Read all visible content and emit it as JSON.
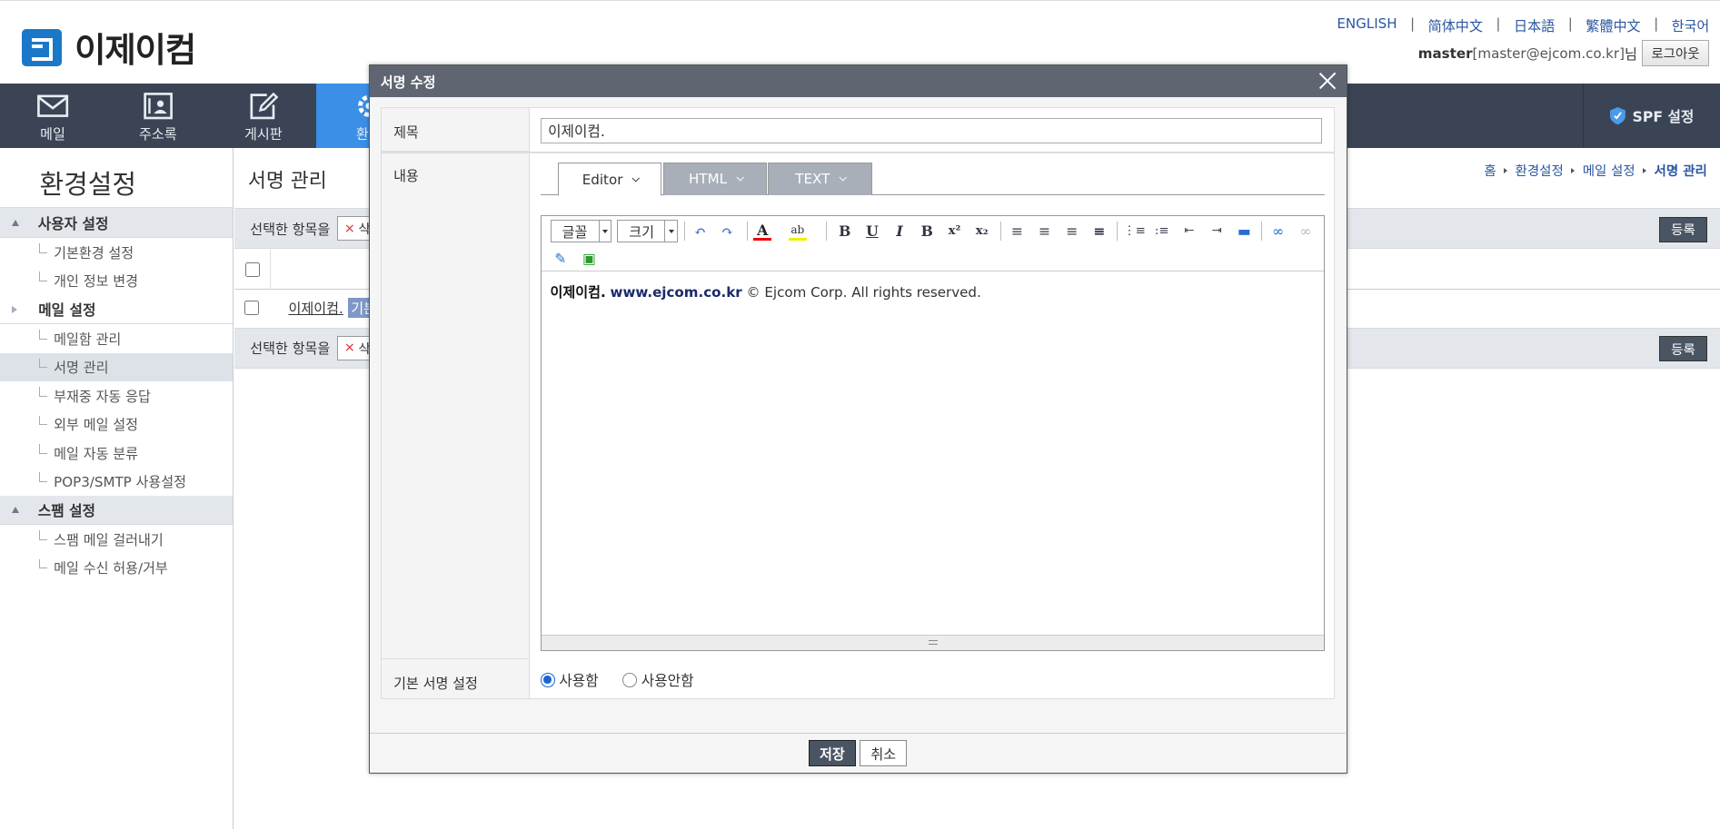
{
  "brand": {
    "name": "이제이컴"
  },
  "languages": [
    "ENGLISH",
    "简体中文",
    "日本語",
    "繁體中文",
    "한국어"
  ],
  "user": {
    "name": "master",
    "email": "[master@ejcom.co.kr]",
    "suffix": "님",
    "logout": "로그아웃"
  },
  "nav": {
    "items": [
      {
        "label": "메일",
        "icon": "mail-icon"
      },
      {
        "label": "주소록",
        "icon": "address-book-icon"
      },
      {
        "label": "게시판",
        "icon": "board-icon"
      },
      {
        "label": "환경",
        "icon": "gear-icon"
      }
    ],
    "spf": "SPF 설정"
  },
  "sidebar": {
    "title": "환경설정",
    "groups": [
      {
        "label": "사용자 설정",
        "items": [
          "기본환경 설정",
          "개인 정보 변경"
        ]
      },
      {
        "label": "메일 설정",
        "items": [
          "메일함 관리",
          "서명 관리",
          "부재중 자동 응답",
          "외부 메일 설정",
          "메일 자동 분류",
          "POP3/SMTP 사용설정"
        ]
      },
      {
        "label": "스팸 설정",
        "items": [
          "스팸 메일 걸러내기",
          "메일 수신 허용/거부"
        ]
      }
    ],
    "active_item": "서명 관리"
  },
  "main": {
    "title": "서명 관리",
    "breadcrumb": [
      "홈",
      "환경설정",
      "메일 설정",
      "서명 관리"
    ],
    "bar_label": "선택한 항목을",
    "delete_label": "삭",
    "register_label": "등록",
    "row": {
      "name": "이제이컴.",
      "badge": "기본"
    }
  },
  "modal": {
    "title": "서명 수정",
    "labels": {
      "subject": "제목",
      "content": "내용",
      "default": "기본 서명 설정"
    },
    "subject_value": "이제이컴.",
    "tabs": [
      "Editor",
      "HTML",
      "TEXT"
    ],
    "font_select": "글꼴",
    "size_select": "크기",
    "content": {
      "bold1": "이제이컴.",
      "bold2": "www.ejcom.co.kr",
      "rest": " © Ejcom Corp. All rights reserved."
    },
    "radio": {
      "on": "사용함",
      "off": "사용안함",
      "selected": "사용함"
    },
    "save": "저장",
    "cancel": "취소"
  },
  "colors": {
    "nav_bg": "#3a4454",
    "nav_active": "#3b8fe6",
    "brand": "#1b78c8",
    "modal_header": "#5f6672"
  }
}
